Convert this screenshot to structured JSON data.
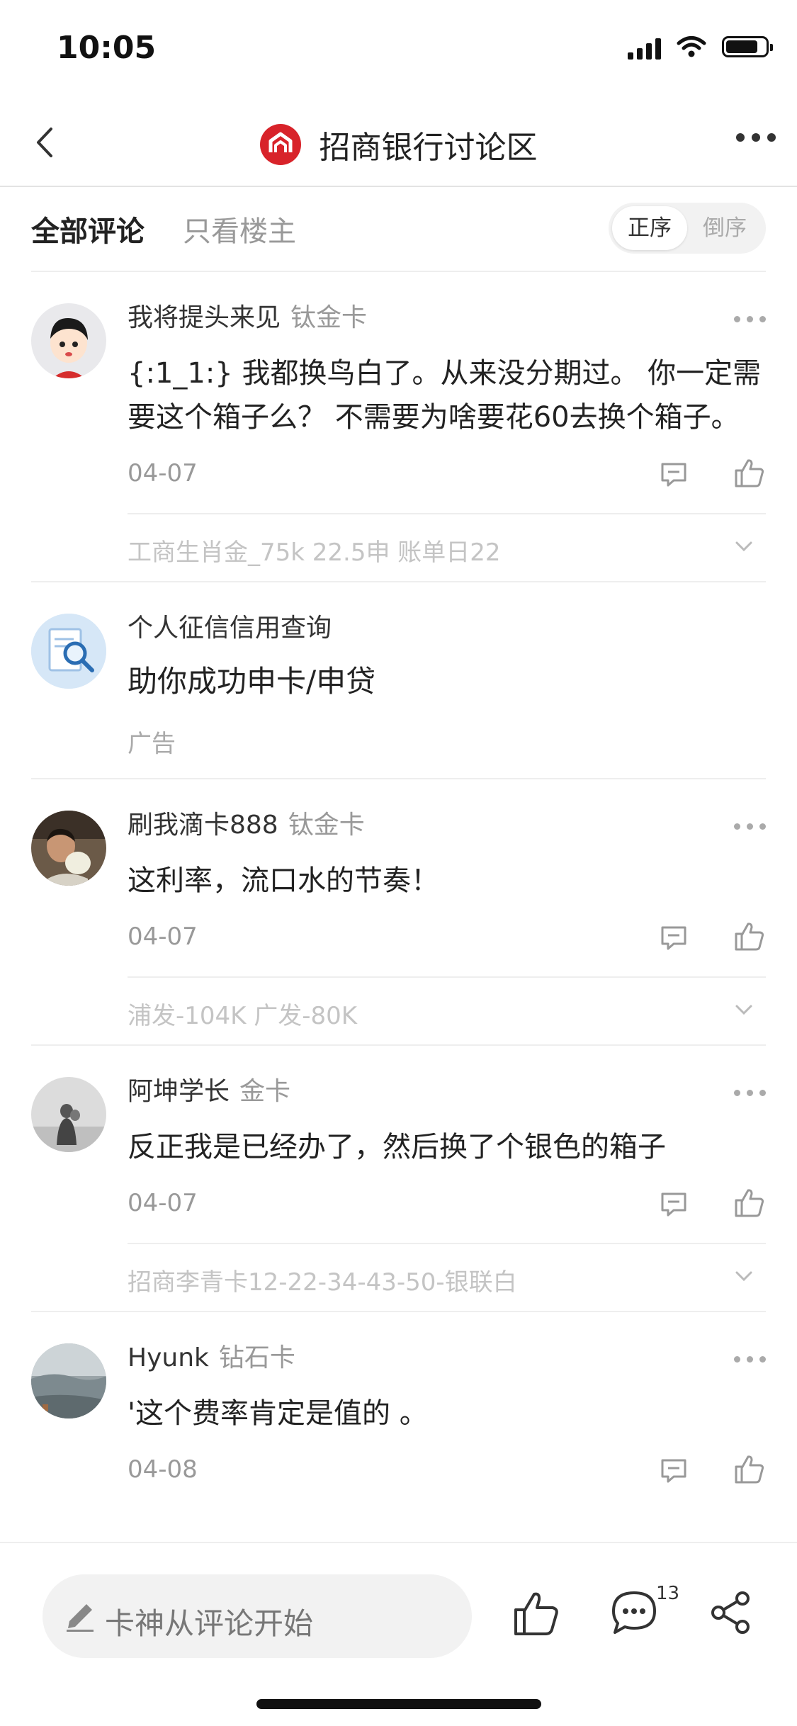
{
  "status_bar": {
    "time": "10:05"
  },
  "nav": {
    "title": "招商银行讨论区"
  },
  "filter": {
    "tab_all": "全部评论",
    "tab_op": "只看楼主",
    "sort_asc": "正序",
    "sort_desc": "倒序"
  },
  "comments": [
    {
      "user": "我将提头来见",
      "badge": "钛金卡",
      "text": "{:1_1:} 我都换鸟白了。从来没分期过。 你一定需要这个箱子么？ 不需要为啥要花60去换个箱子。",
      "date": "04-07",
      "sub_reply": "工商生肖金_75k 22.5申 账单日22"
    },
    {
      "user": "刷我滴卡888",
      "badge": "钛金卡",
      "text": "这利率，流口水的节奏！",
      "date": "04-07",
      "sub_reply": "浦发-104K 广发-80K"
    },
    {
      "user": "阿坤学长",
      "badge": "金卡",
      "text": "反正我是已经办了，然后换了个银色的箱子",
      "date": "04-07",
      "sub_reply": "招商李青卡12-22-34-43-50-银联白"
    },
    {
      "user": "Hyunk",
      "badge": "钻石卡",
      "text": "'这个费率肯定是值的 。",
      "date": "04-08",
      "sub_reply": ""
    }
  ],
  "ad": {
    "title": "个人征信信用查询",
    "desc": "助你成功申卡/申贷",
    "tag": "广告"
  },
  "bottom_bar": {
    "placeholder": "卡神从评论开始",
    "comment_count": "13"
  },
  "colors": {
    "brand_red": "#d8232a",
    "muted_text": "#999999",
    "sub_text": "#c4c4c4"
  }
}
